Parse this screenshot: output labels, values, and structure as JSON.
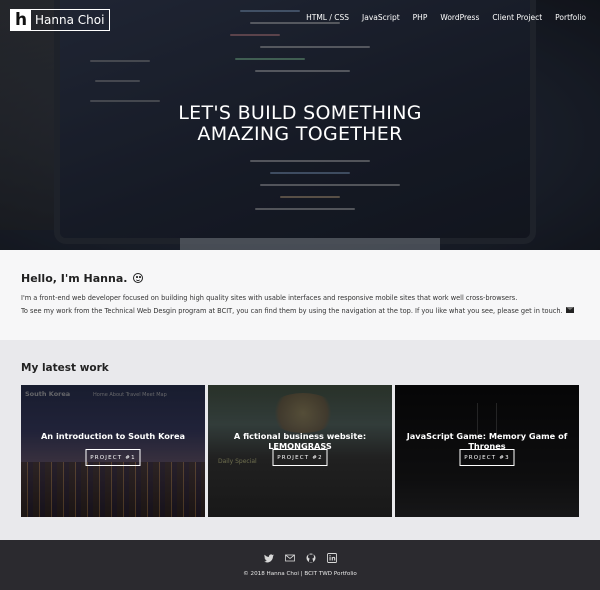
{
  "brand": {
    "logo_letter": "h",
    "name": "Hanna Choi"
  },
  "nav": [
    "HTML / CSS",
    "JavaScript",
    "PHP",
    "WordPress",
    "Client Project",
    "Portfolio"
  ],
  "hero": {
    "line1": "LET'S BUILD SOMETHING",
    "line2": "AMAZING TOGETHER"
  },
  "intro": {
    "heading": "Hello, I'm Hanna.",
    "p1": "I'm a front-end web developer focused on building high quality sites with usable interfaces and responsive mobile sites that work well cross-browsers.",
    "p2": "To see my work from the Technical Web Desgin program at BCIT, you can find them by using the navigation at the top. If you like what you see, please get in touch."
  },
  "work": {
    "heading": "My latest work",
    "cards": [
      {
        "title": "An introduction to South Korea",
        "button": "PROJECT #1",
        "mini_title": "South Korea",
        "mini_nav": "Home   About   Travel   Meet   Map"
      },
      {
        "title": "A fictional business website: LEMONGRASS",
        "button": "PROJECT #2",
        "mini_title": "Daily Special"
      },
      {
        "title": "JavaScript Game: Memory Game of Thrones",
        "button": "PROJECT #3"
      }
    ]
  },
  "footer": {
    "icons": [
      "twitter-icon",
      "envelope-icon",
      "github-icon",
      "linkedin-icon"
    ],
    "copyright": "© 2018 Hanna Choi | BCIT TWD Portfolio"
  },
  "colors": {
    "footer_bg": "#2b2a2f",
    "intro_bg": "#f7f7f8",
    "work_bg": "#e9e9ec"
  }
}
